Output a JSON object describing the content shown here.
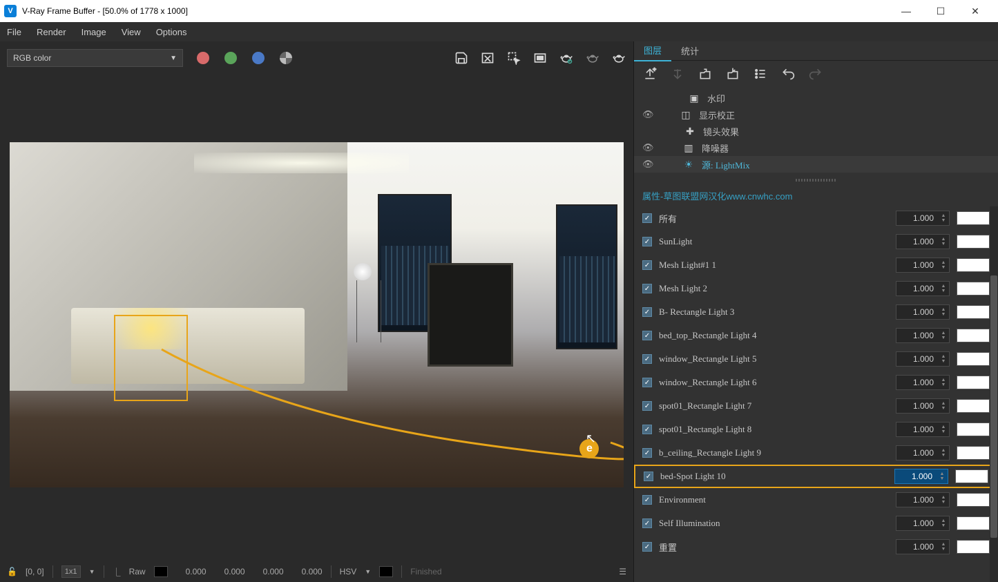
{
  "window": {
    "title": "V-Ray Frame Buffer - [50.0% of 1778 x 1000]"
  },
  "menu": {
    "file": "File",
    "render": "Render",
    "image": "Image",
    "view": "View",
    "options": "Options"
  },
  "toolbar": {
    "channel": "RGB color"
  },
  "statusbar": {
    "coords": "[0, 0]",
    "pixel": "1x1",
    "raw": "Raw",
    "r": "0.000",
    "g": "0.000",
    "b": "0.000",
    "a": "0.000",
    "mode": "HSV",
    "finished": "Finished"
  },
  "tabs": {
    "layers": "图层",
    "stats": "统计"
  },
  "layers": {
    "watermark": "水印",
    "display_correct": "显示校正",
    "lens_fx": "镜头效果",
    "denoiser": "降噪器",
    "source": "源: LightMix"
  },
  "props": {
    "title_prefix": "属性-草图联盟网汉化",
    "title_url": "www.cnwhc.com"
  },
  "lights": [
    {
      "name": "所有",
      "value": "1.000",
      "color": "#ffffff"
    },
    {
      "name": "SunLight",
      "value": "1.000",
      "color": "#ffffff"
    },
    {
      "name": "Mesh Light#1 1",
      "value": "1.000",
      "color": "#ffffff"
    },
    {
      "name": "Mesh Light 2",
      "value": "1.000",
      "color": "#ffffff"
    },
    {
      "name": "B- Rectangle Light 3",
      "value": "1.000",
      "color": "#ffffff"
    },
    {
      "name": "bed_top_Rectangle Light 4",
      "value": "1.000",
      "color": "#ffffff"
    },
    {
      "name": "window_Rectangle Light 5",
      "value": "1.000",
      "color": "#ffffff"
    },
    {
      "name": "window_Rectangle Light 6",
      "value": "1.000",
      "color": "#ffffff"
    },
    {
      "name": "spot01_Rectangle Light 7",
      "value": "1.000",
      "color": "#ffffff"
    },
    {
      "name": "spot01_Rectangle Light 8",
      "value": "1.000",
      "color": "#ffffff"
    },
    {
      "name": "b_ceiling_Rectangle Light 9",
      "value": "1.000",
      "color": "#ffffff"
    },
    {
      "name": "bed-Spot Light 10",
      "value": "1.000",
      "color": "#ffffff",
      "highlighted": true
    },
    {
      "name": "Environment",
      "value": "1.000",
      "color": "#ffffff"
    },
    {
      "name": "Self Illumination",
      "value": "1.000",
      "color": "#ffffff"
    },
    {
      "name": "重置",
      "value": "1.000",
      "color": "#ffffff"
    }
  ],
  "annotation": {
    "letter": "e"
  }
}
